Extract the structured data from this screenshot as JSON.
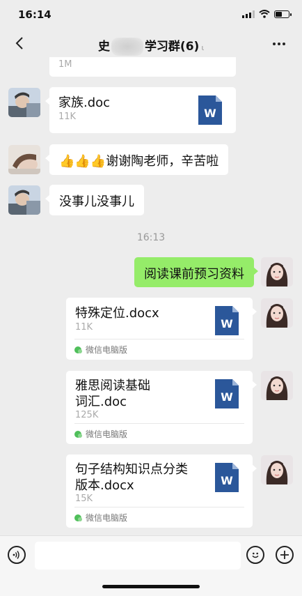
{
  "status_bar": {
    "time": "16:14"
  },
  "nav": {
    "back_icon": "chevron-left-icon",
    "title_prefix": "史",
    "title_suffix": "学习群(6)",
    "mute_icon": "ear-icon",
    "more_icon": "ellipsis-icon"
  },
  "messages": {
    "m0": {
      "size": "1M"
    },
    "m1": {
      "title": "家族.doc",
      "size": "11K",
      "icon": "W"
    },
    "m2": {
      "emoji": "👍👍👍",
      "text": "谢谢陶老师，辛苦啦"
    },
    "m3": {
      "text": "没事儿没事儿"
    },
    "time_label": "16:13",
    "m4": {
      "text": "阅读课前预习资料"
    },
    "m5": {
      "title": "特殊定位.docx",
      "size": "11K",
      "icon": "W",
      "source": "微信电脑版"
    },
    "m6": {
      "title_line1": "雅思阅读基础",
      "title_line2": "词汇.doc",
      "size": "125K",
      "icon": "W",
      "source": "微信电脑版"
    },
    "m7": {
      "title_line1": "句子结构知识点分类",
      "title_line2": "版本.docx",
      "size": "15K",
      "icon": "W",
      "source": "微信电脑版"
    }
  },
  "input_bar": {
    "voice_icon": "voice-icon",
    "emoji_icon": "emoji-icon",
    "add_icon": "plus-icon",
    "placeholder": ""
  },
  "colors": {
    "background": "#ededed",
    "sent_bubble": "#95ec69",
    "word_blue": "#2b579a"
  }
}
